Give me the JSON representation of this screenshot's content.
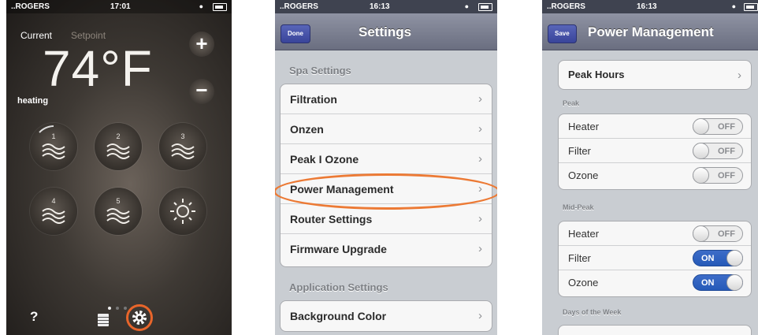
{
  "phone1": {
    "status": {
      "carrier": "..ROGERS",
      "time": "17:01"
    },
    "mode_current": "Current",
    "mode_setpoint": "Setpoint",
    "temperature": "74°F",
    "state": "heating",
    "plus_label": "+",
    "minus_label": "−",
    "jets": [
      {
        "num": "1"
      },
      {
        "num": "2"
      },
      {
        "num": "3"
      },
      {
        "num": "4"
      },
      {
        "num": "5"
      }
    ],
    "help_label": "?",
    "accent": "#e8652a"
  },
  "phone2": {
    "status": {
      "carrier": "..ROGERS",
      "time": "16:13"
    },
    "nav_button": "Done",
    "title": "Settings",
    "section_spa": "Spa Settings",
    "spa_items": [
      "Filtration",
      "Onzen",
      "Peak I Ozone",
      "Power Management",
      "Router Settings",
      "Firmware Upgrade"
    ],
    "section_app": "Application Settings",
    "app_items": [
      "Background Color"
    ],
    "chevron": "›"
  },
  "phone3": {
    "status": {
      "carrier": "..ROGERS",
      "time": "16:13"
    },
    "nav_button": "Save",
    "title": "Power Management",
    "peak_hours_label": "Peak Hours",
    "peak_section": "Peak",
    "peak": [
      {
        "label": "Heater",
        "state": "OFF"
      },
      {
        "label": "Filter",
        "state": "OFF"
      },
      {
        "label": "Ozone",
        "state": "OFF"
      }
    ],
    "midpeak_section": "Mid-Peak",
    "midpeak": [
      {
        "label": "Heater",
        "state": "OFF"
      },
      {
        "label": "Filter",
        "state": "ON"
      },
      {
        "label": "Ozone",
        "state": "ON"
      }
    ],
    "days_section": "Days of the Week",
    "chevron": "›"
  }
}
